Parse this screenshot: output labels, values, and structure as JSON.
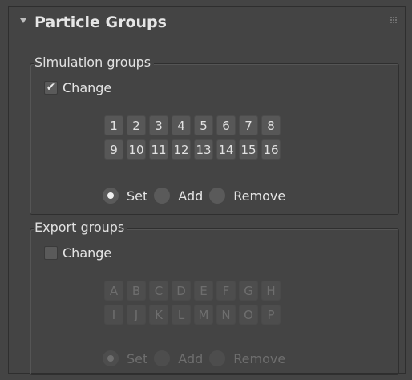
{
  "rollout": {
    "title": "Particle Groups"
  },
  "simulation": {
    "label": "Simulation groups",
    "change_label": "Change",
    "change_checked": true,
    "check_glyph": "✔",
    "buttons": [
      "1",
      "2",
      "3",
      "4",
      "5",
      "6",
      "7",
      "8",
      "9",
      "10",
      "11",
      "12",
      "13",
      "14",
      "15",
      "16"
    ],
    "modes": [
      {
        "label": "Set",
        "selected": true
      },
      {
        "label": "Add",
        "selected": false
      },
      {
        "label": "Remove",
        "selected": false
      }
    ]
  },
  "export": {
    "label": "Export groups",
    "change_label": "Change",
    "change_checked": false,
    "buttons": [
      "A",
      "B",
      "C",
      "D",
      "E",
      "F",
      "G",
      "H",
      "I",
      "J",
      "K",
      "L",
      "M",
      "N",
      "O",
      "P"
    ],
    "modes": [
      {
        "label": "Set",
        "selected": true
      },
      {
        "label": "Add",
        "selected": false
      },
      {
        "label": "Remove",
        "selected": false
      }
    ]
  }
}
